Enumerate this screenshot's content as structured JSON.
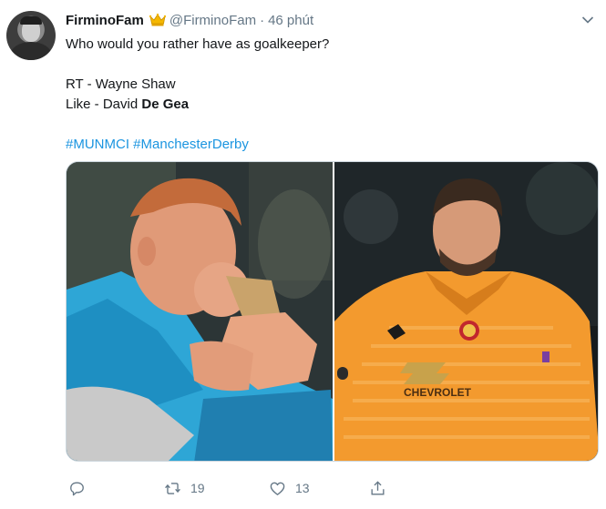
{
  "tweet": {
    "display_name": "FirminoFam",
    "handle": "@FirminoFam",
    "separator": "·",
    "time": "46 phút",
    "lines": {
      "question": "Who would you rather have as goalkeeper?",
      "rt_option": "RT - Wayne Shaw",
      "like_prefix": "Like - David ",
      "like_bold": "De Gea",
      "hashtag1": "#MUNMCI",
      "hashtag2": "#ManchesterDerby"
    },
    "jersey_sponsor": "CHEVROLET",
    "actions": {
      "reply_count": "",
      "retweet_count": "19",
      "like_count": "13"
    },
    "icons": [
      "crown-icon",
      "chevron-down-icon",
      "reply-icon",
      "retweet-icon",
      "heart-icon",
      "share-icon"
    ],
    "colors": {
      "hashtag": "#1b95e0",
      "muted": "#657786",
      "text": "#14171a",
      "keeper_kit": "#f39a2e"
    }
  }
}
